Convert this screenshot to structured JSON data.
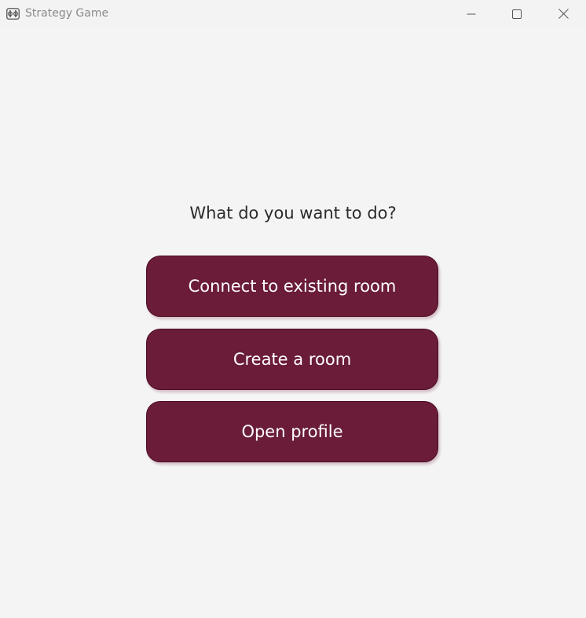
{
  "window": {
    "title": "Strategy Game",
    "app_icon": "gamepad-icon",
    "controls": {
      "minimize_icon": "minimize-icon",
      "maximize_icon": "maximize-icon",
      "close_icon": "close-icon"
    }
  },
  "main": {
    "question": "What do you want to do?",
    "buttons": [
      {
        "label": "Connect to existing room"
      },
      {
        "label": "Create a room"
      },
      {
        "label": "Open profile"
      }
    ]
  },
  "colors": {
    "button_fill": "#6b1c38",
    "button_border": "#4e0f26",
    "background": "#f4f4f4",
    "title_text": "#8a8a8a"
  }
}
